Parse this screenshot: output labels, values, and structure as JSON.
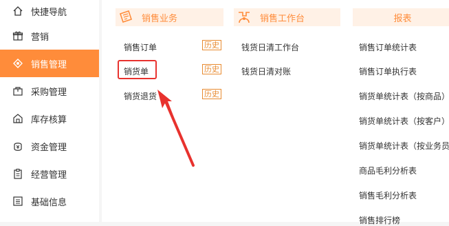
{
  "sidebar": {
    "items": [
      {
        "label": "快捷导航",
        "icon": "home-icon",
        "active": false
      },
      {
        "label": "营销",
        "icon": "gift-icon",
        "active": false
      },
      {
        "label": "销售管理",
        "icon": "sales-icon",
        "active": true
      },
      {
        "label": "采购管理",
        "icon": "bag-icon",
        "active": false
      },
      {
        "label": "库存核算",
        "icon": "warehouse-icon",
        "active": false
      },
      {
        "label": "资金管理",
        "icon": "money-icon",
        "active": false
      },
      {
        "label": "经营管理",
        "icon": "clipboard-icon",
        "active": false
      },
      {
        "label": "基础信息",
        "icon": "list-icon",
        "active": false
      }
    ]
  },
  "columns": {
    "sales_business": {
      "title": "销售业务",
      "items": [
        {
          "label": "销售订单",
          "badge": "历史"
        },
        {
          "label": "销货单",
          "badge": "历史"
        },
        {
          "label": "销货退货",
          "badge": "历史"
        }
      ]
    },
    "sales_workbench": {
      "title": "销售工作台",
      "items": [
        {
          "label": "钱货日清工作台"
        },
        {
          "label": "钱货日清对账"
        }
      ]
    },
    "reports": {
      "title": "报表",
      "items": [
        {
          "label": "销售订单统计表"
        },
        {
          "label": "销售订单执行表"
        },
        {
          "label": "销货单统计表（按商品）"
        },
        {
          "label": "销货单统计表（按客户）"
        },
        {
          "label": "销货单统计表（按业务员）"
        },
        {
          "label": "商品毛利分析表"
        },
        {
          "label": "销售毛利分析表"
        },
        {
          "label": "销售排行榜"
        }
      ]
    }
  },
  "colors": {
    "accent": "#ff8c3a",
    "header_bg": "#fff1e6",
    "highlight": "#e8322e"
  }
}
